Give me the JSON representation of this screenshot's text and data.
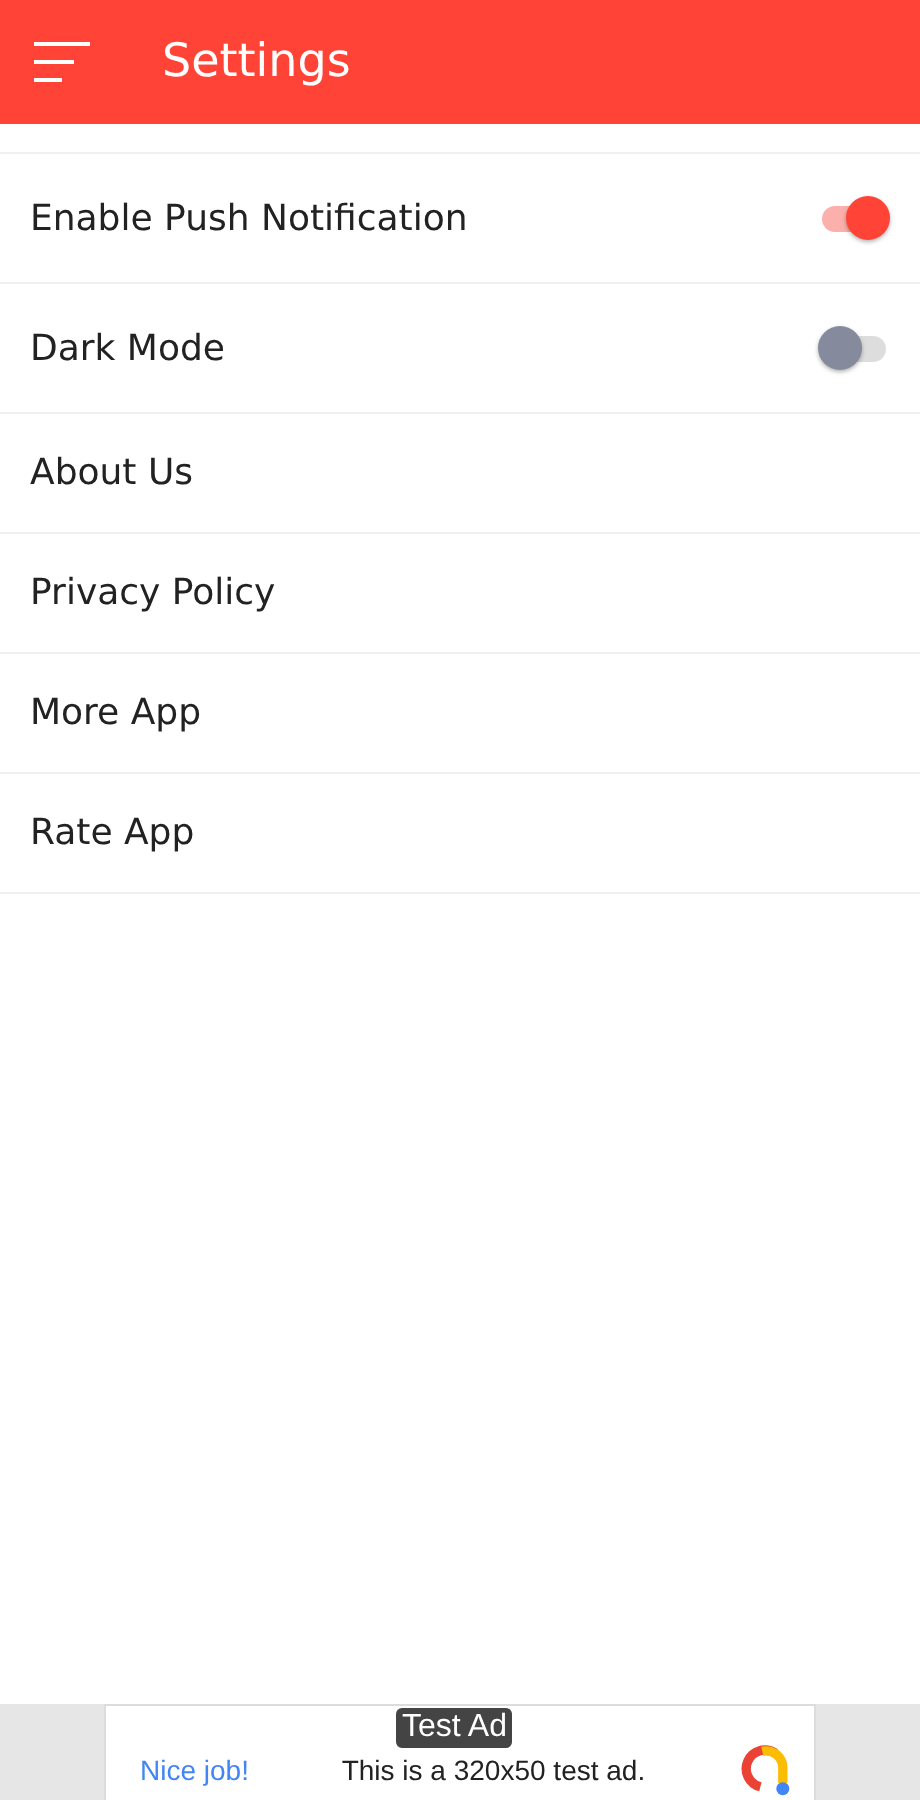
{
  "app_bar": {
    "title": "Settings"
  },
  "settings": [
    {
      "label": "Enable Push Notification",
      "kind": "toggle",
      "on": true
    },
    {
      "label": "Dark Mode",
      "kind": "toggle",
      "on": false
    },
    {
      "label": "About Us",
      "kind": "link"
    },
    {
      "label": "Privacy Policy",
      "kind": "link"
    },
    {
      "label": "More App",
      "kind": "link"
    },
    {
      "label": "Rate App",
      "kind": "link"
    }
  ],
  "ad_banner": {
    "badge": "Test Ad",
    "headline": "Nice job!",
    "text": "This is a 320x50 test ad."
  }
}
